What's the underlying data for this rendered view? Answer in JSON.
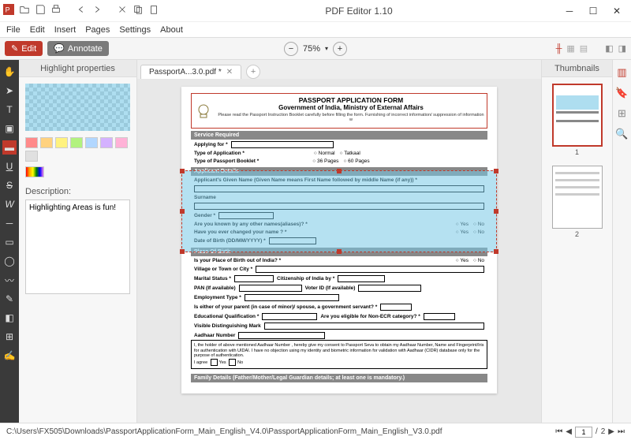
{
  "app": {
    "title": "PDF Editor 1.10"
  },
  "menubar": [
    "File",
    "Edit",
    "Insert",
    "Pages",
    "Settings",
    "About"
  ],
  "toolbar": {
    "edit": "Edit",
    "annotate": "Annotate",
    "zoom": "75%"
  },
  "left_panel": {
    "title": "Highlight properties",
    "description_label": "Description:",
    "description_value": "Highlighting Areas is fun!",
    "swatches": [
      "#ff8a8a",
      "#ffd27f",
      "#fff27f",
      "#b2f27f",
      "#b2d7ff",
      "#d4b2ff",
      "#ffb2d7",
      "#e0e0e0"
    ],
    "rainbow": true
  },
  "tabs": {
    "active": "PassportA...3.0.pdf *"
  },
  "thumbnails": {
    "title": "Thumbnails",
    "labels": [
      "1",
      "2"
    ],
    "active": 0
  },
  "status": {
    "path": "C:\\Users\\FX505\\Downloads\\PassportApplicationForm_Main_English_V4.0\\PassportApplicationForm_Main_English_V3.0.pdf",
    "page_current": "1",
    "page_total": "2"
  },
  "form": {
    "title": "PASSPORT APPLICATION FORM",
    "subtitle": "Government of India, Ministry of External Affairs",
    "instruction": "Please read the Passport Instruction Booklet carefully before filling the form. Furnishing of incorrect information/ suppression of information w",
    "sections": {
      "service": "Service Required",
      "applicant": "Applicant Details",
      "pob": "Place Of Birth",
      "family": "Family Details (Father/Mother/Legal Guardian details; at least one is mandatory.)"
    },
    "labels": {
      "applying_for": "Applying for *",
      "type_app": "Type of Application *",
      "type_booklet": "Type of Passport Booklet *",
      "given_name": "Applicant's Given Name (Given Name means First Name followed by middle Name (if any)) *",
      "surname": "Surname",
      "gender": "Gender *",
      "aliases": "Are you known by any other names(aliases)? *",
      "changed": "Have you ever changed your name ? *",
      "dob": "Date of Birth (DD/MM/YYYY) *",
      "pob_out": "Is your Place of Birth out of India? *",
      "village": "Village or Town or City *",
      "marital": "Marital Status *",
      "citizenship": "Citizenship of India by *",
      "pan": "PAN (If available)",
      "voter": "Voter ID (If available)",
      "employment": "Employment Type *",
      "parent_gov": "Is either of your parent (in case of minor)/ spouse, a government servant? *",
      "edu": "Educational Qualification *",
      "nonecr": "Are you eligible for Non-ECR category? *",
      "marks": "Visible Distinguishing Mark",
      "aadhaar": "Aadhaar Number",
      "consent": "I, the holder of above mentioned Aadhaar Number , hereby give my consent to Passport Seva to obtain my Aadhaar Number, Name and Fingerprint/Iris for authentication with UIDAI. I have no objection using my identity and biometric information for validation with Aadhaar (CIDR) database only for the purpose of authentication.",
      "agree": "I agree",
      "yes": "Yes",
      "no": "No"
    },
    "options": {
      "type_app": [
        "Normal",
        "Tatkaal"
      ],
      "booklet": [
        "36 Pages",
        "60 Pages"
      ],
      "yesno": [
        "Yes",
        "No"
      ]
    }
  }
}
